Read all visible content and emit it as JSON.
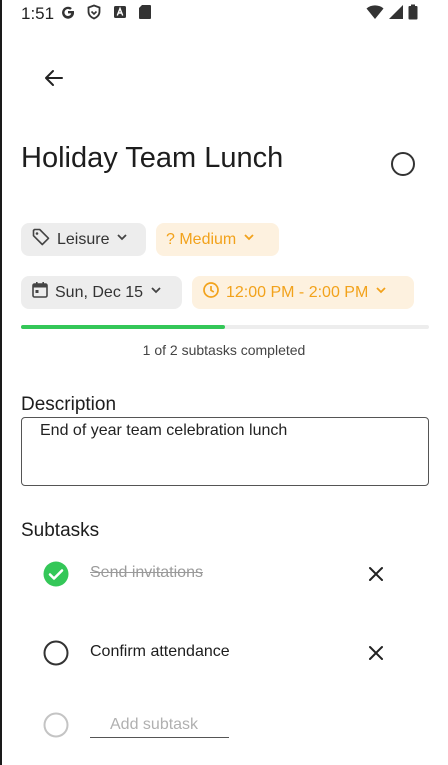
{
  "status_bar": {
    "time": "1:51",
    "left_icons": [
      "google-icon",
      "shield-icon",
      "a-box-icon",
      "sd-card-icon"
    ],
    "right_icons": [
      "wifi-icon",
      "signal-icon",
      "battery-icon"
    ]
  },
  "task": {
    "title": "Holiday Team Lunch",
    "completed": false
  },
  "chips": {
    "category": "Leisure",
    "priority": "? Medium",
    "date": "Sun, Dec 15",
    "time": "12:00 PM - 2:00 PM"
  },
  "progress": {
    "fraction": 0.5,
    "text": "1 of 2 subtasks completed"
  },
  "description": {
    "label": "Description",
    "value": "End of year team celebration lunch"
  },
  "subtasks": {
    "label": "Subtasks",
    "items": [
      {
        "label": "Send invitations",
        "done": true
      },
      {
        "label": "Confirm attendance",
        "done": false
      }
    ],
    "add_placeholder": "Add subtask"
  },
  "colors": {
    "accent_orange": "#f2a21b",
    "orange_chip_bg": "#fdf1df",
    "grey_chip_bg": "#ededed",
    "progress_green": "#34c758"
  }
}
